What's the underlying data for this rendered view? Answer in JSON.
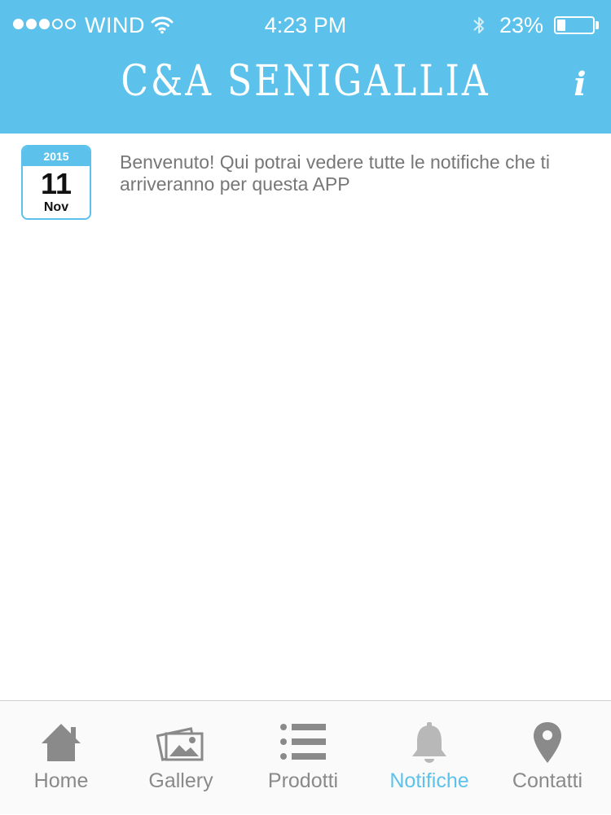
{
  "status_bar": {
    "signal_dots_filled": 3,
    "signal_dots_total": 5,
    "carrier": "WIND",
    "time": "4:23 PM",
    "battery_percent_label": "23%",
    "battery_level": 0.23
  },
  "header": {
    "title": "C&A SENIGALLIA",
    "info_label": "i",
    "background_color": "#5dc2eb"
  },
  "notifications": [
    {
      "year": "2015",
      "day": "11",
      "month": "Nov",
      "message": "Benvenuto! Qui potrai vedere tutte le notifiche che ti arriveranno per questa APP"
    }
  ],
  "tab_bar": {
    "active_color": "#5dc2eb",
    "inactive_color": "#8a8a8a",
    "tabs": [
      {
        "label": "Home",
        "icon": "home-icon",
        "active": false
      },
      {
        "label": "Gallery",
        "icon": "gallery-icon",
        "active": false
      },
      {
        "label": "Prodotti",
        "icon": "list-icon",
        "active": false
      },
      {
        "label": "Notifiche",
        "icon": "bell-icon",
        "active": true
      },
      {
        "label": "Contatti",
        "icon": "location-pin-icon",
        "active": false
      }
    ]
  }
}
